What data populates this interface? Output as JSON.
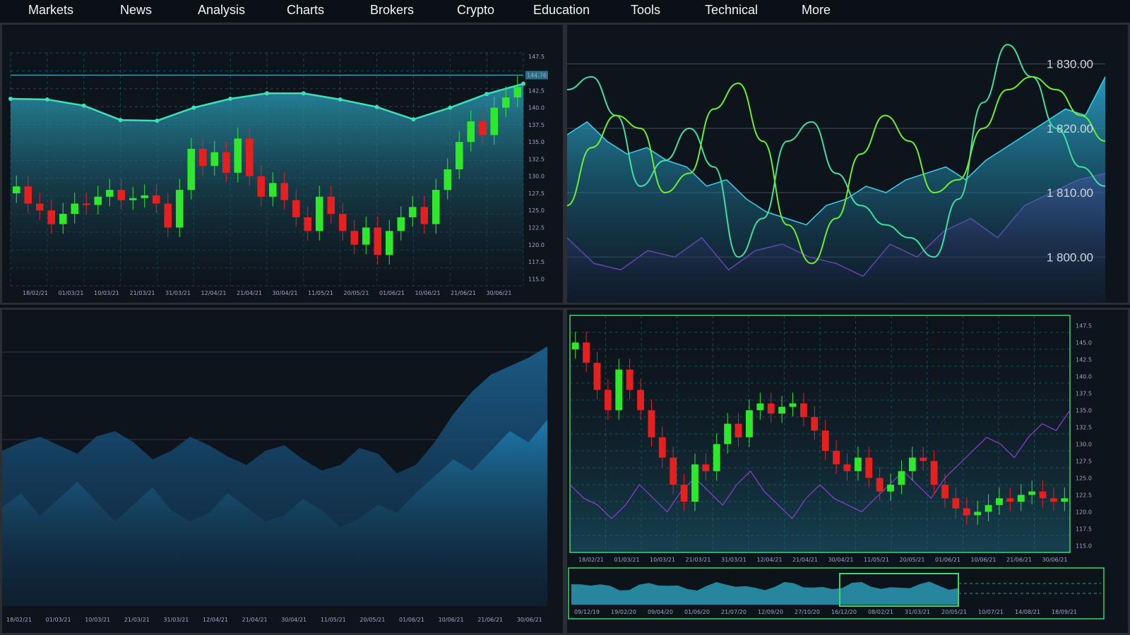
{
  "nav": {
    "items": [
      "Markets",
      "News",
      "Analysis",
      "Charts",
      "Brokers",
      "Crypto",
      "Education",
      "Tools",
      "Technical",
      "More"
    ]
  },
  "colors": {
    "background": "#0e141c",
    "up": "#2ee82a",
    "down": "#e81f1f",
    "teal_line": "#3fe0b5",
    "area": "#1f7aa6",
    "purple": "#8e3fd1",
    "lime": "#6cf02b",
    "frame_green": "#3ad86a"
  },
  "chart_data": [
    {
      "type": "candlestick",
      "position": "top-left",
      "x_ticks": [
        "18/02/21",
        "01/03/21",
        "10/03/21",
        "21/03/21",
        "31/03/21",
        "12/04/21",
        "21/04/21",
        "30/04/21",
        "11/05/21",
        "20/05/21",
        "01/06/21",
        "10/06/21",
        "21/06/21",
        "30/06/21"
      ],
      "y_ticks": [
        "147.5",
        "142.5",
        "140.0",
        "137.5",
        "135.0",
        "132.5",
        "130.0",
        "127.5",
        "125.0",
        "122.5",
        "120.0",
        "117.5",
        "115.0"
      ],
      "ylim": [
        114,
        148
      ],
      "price_label": "144.76",
      "price_level": 144.76,
      "overlay_line": [
        141.3,
        141.2,
        140.3,
        138.2,
        138.1,
        140.0,
        141.3,
        142.1,
        142.1,
        141.2,
        140.1,
        138.3,
        140.0,
        142.0,
        143.5
      ],
      "closes": [
        128.5,
        126.0,
        125.0,
        123.0,
        124.5,
        126.0,
        125.8,
        127.0,
        128.0,
        126.5,
        126.8,
        127.2,
        126.0,
        122.5,
        128.0,
        134.0,
        131.5,
        133.5,
        130.5,
        135.5,
        130.0,
        127.0,
        129.0,
        126.5,
        124.0,
        122.0,
        127.0,
        124.5,
        122.0,
        120.0,
        122.5,
        118.5,
        122.0,
        124.0,
        125.5,
        123.0,
        128.0,
        131.0,
        135.0,
        138.0,
        136.0,
        140.0,
        141.5,
        143.0
      ]
    },
    {
      "type": "line",
      "position": "top-right",
      "y_ticks": [
        "1 830.00",
        "1 820.00",
        "1 810.00",
        "1 800.00"
      ],
      "ylim": [
        1794,
        1835
      ],
      "series": [
        {
          "values": [
            1819,
            1821,
            1818,
            1816,
            1817,
            1815,
            1814,
            1811,
            1812,
            1809,
            1807,
            1806,
            1805,
            1808,
            1809,
            1811,
            1810,
            1812,
            1813,
            1814,
            1812,
            1815,
            1817,
            1819,
            1821,
            1823,
            1822,
            1828
          ]
        },
        {
          "values": [
            1826,
            1828,
            1822,
            1811,
            1815,
            1820,
            1814,
            1800,
            1806,
            1818,
            1821,
            1813,
            1808,
            1805,
            1803,
            1800,
            1809,
            1824,
            1833,
            1828,
            1820,
            1814,
            1811
          ]
        },
        {
          "values": [
            1808,
            1817,
            1822,
            1820,
            1810,
            1813,
            1823,
            1827,
            1818,
            1805,
            1799,
            1806,
            1816,
            1822,
            1818,
            1810,
            1812,
            1820,
            1826,
            1828,
            1826,
            1822,
            1818
          ]
        },
        {
          "values": [
            1803,
            1799,
            1798,
            1801,
            1800,
            1803,
            1798,
            1801,
            1802,
            1800,
            1799,
            1797,
            1802,
            1800,
            1804,
            1806,
            1803,
            1808,
            1810,
            1812,
            1813
          ]
        }
      ]
    },
    {
      "type": "area",
      "position": "bottom-left",
      "x_ticks": [
        "18/02/21",
        "01/03/21",
        "10/03/21",
        "21/03/21",
        "31/03/21",
        "12/04/21",
        "21/04/21",
        "30/04/21",
        "11/05/21",
        "20/05/21",
        "01/06/21",
        "10/06/21",
        "21/06/21",
        "30/06/21"
      ],
      "series": [
        {
          "values": [
            0.55,
            0.58,
            0.6,
            0.57,
            0.54,
            0.6,
            0.62,
            0.58,
            0.52,
            0.55,
            0.6,
            0.57,
            0.53,
            0.5,
            0.55,
            0.57,
            0.52,
            0.48,
            0.5,
            0.56,
            0.54,
            0.47,
            0.5,
            0.58,
            0.68,
            0.76,
            0.82,
            0.85,
            0.88,
            0.92
          ]
        },
        {
          "values": [
            0.35,
            0.4,
            0.32,
            0.38,
            0.44,
            0.37,
            0.3,
            0.36,
            0.42,
            0.34,
            0.3,
            0.33,
            0.4,
            0.35,
            0.3,
            0.32,
            0.38,
            0.34,
            0.28,
            0.31,
            0.36,
            0.33,
            0.4,
            0.46,
            0.52,
            0.48,
            0.55,
            0.62,
            0.58,
            0.66
          ]
        }
      ]
    },
    {
      "type": "candlestick",
      "position": "bottom-right",
      "x_ticks": [
        "18/02/21",
        "01/03/21",
        "10/03/21",
        "21/03/21",
        "31/03/21",
        "12/04/21",
        "21/04/21",
        "30/04/21",
        "11/05/21",
        "20/05/21",
        "01/06/21",
        "10/06/21",
        "21/06/21",
        "30/06/21"
      ],
      "y_ticks": [
        "147.5",
        "145.0",
        "142.5",
        "140.0",
        "137.5",
        "135.0",
        "132.5",
        "130.0",
        "127.5",
        "125.0",
        "122.5",
        "120.0",
        "117.5",
        "115.0"
      ],
      "ylim": [
        114,
        149
      ],
      "closes": [
        145.0,
        142.0,
        138.0,
        135.0,
        141.0,
        138.0,
        135.0,
        131.0,
        128.0,
        124.0,
        121.5,
        127.0,
        126.0,
        130.0,
        133.0,
        131.0,
        135.0,
        136.0,
        134.5,
        135.5,
        136.0,
        134.0,
        132.0,
        129.0,
        127.0,
        126.0,
        128.0,
        125.0,
        123.0,
        124.0,
        126.0,
        128.0,
        127.5,
        124.0,
        122.0,
        120.5,
        119.5,
        120.0,
        121.0,
        122.0,
        121.5,
        122.5,
        123.0,
        122.0,
        121.5,
        122.0
      ],
      "purple": [
        124,
        122,
        121,
        119,
        121,
        124,
        122,
        120,
        123,
        125,
        123,
        121,
        124,
        126,
        123,
        121,
        119,
        122,
        124,
        122,
        121,
        120,
        122,
        124,
        126,
        124,
        122,
        125,
        127,
        129,
        131,
        130,
        128,
        131,
        133,
        132,
        135
      ],
      "navigator_ticks": [
        "09/12/19",
        "19/02/20",
        "09/04/20",
        "01/06/20",
        "21/07/20",
        "12/09/20",
        "27/10/20",
        "16/12/20",
        "08/02/21",
        "31/03/21",
        "20/05/21",
        "10/07/21",
        "14/08/21",
        "18/09/21"
      ]
    }
  ]
}
